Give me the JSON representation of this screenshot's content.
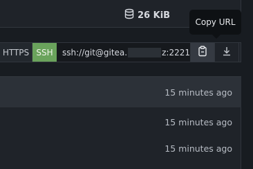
{
  "header": {
    "repo_size": "26 KiB",
    "repo_size_icon": "database-icon"
  },
  "tooltip": {
    "text": "Copy URL"
  },
  "clone": {
    "https_label": "HTTPS",
    "ssh_label": "SSH",
    "url_prefix": "ssh://git@gitea.",
    "url_suffix": "z:2221",
    "copy_icon": "clipboard-icon",
    "download_icon": "download-icon"
  },
  "files": {
    "rows": [
      {
        "time": "15 minutes ago"
      },
      {
        "time": "15 minutes ago"
      },
      {
        "time": "15 minutes ago"
      }
    ]
  },
  "colors": {
    "background": "#181c21",
    "panel": "#1f2329",
    "ssh_active": "#6aa35c",
    "tooltip": "#0e1114"
  }
}
